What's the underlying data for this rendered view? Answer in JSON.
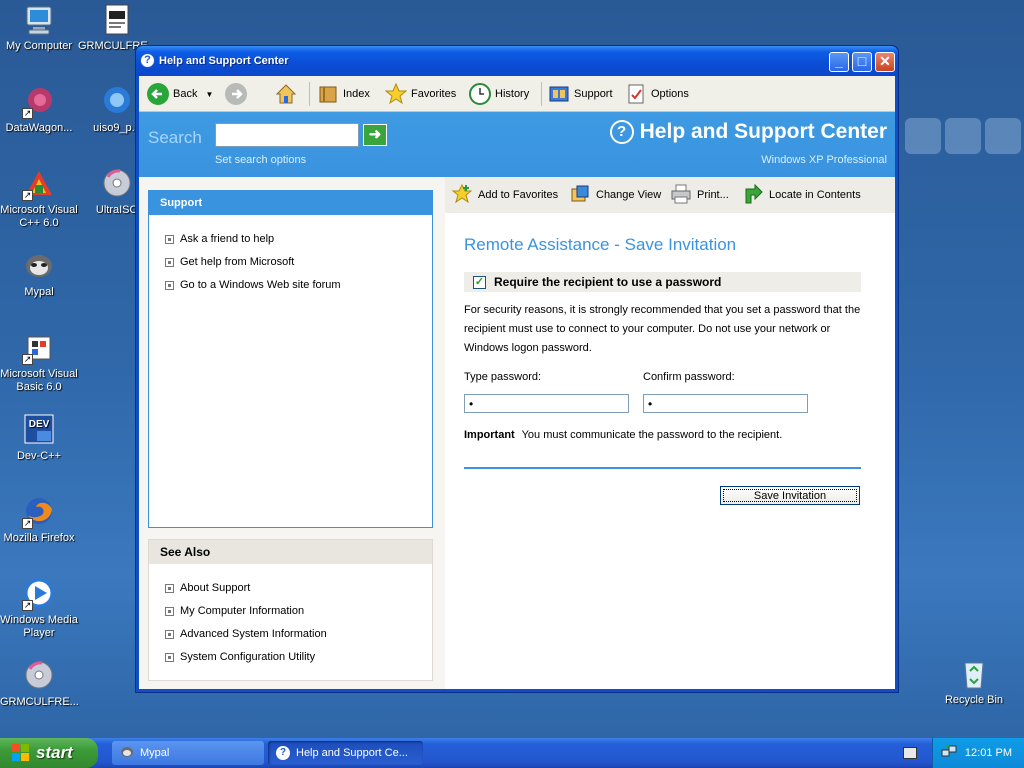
{
  "desktop": {
    "icons": [
      {
        "label": "My Computer"
      },
      {
        "label": "GRMCULFRE..."
      },
      {
        "label": "DataWagon..."
      },
      {
        "label": "uiso9_p..."
      },
      {
        "label": "Microsoft Visual C++ 6.0"
      },
      {
        "label": "UltraISO"
      },
      {
        "label": "Mypal"
      },
      {
        "label": "Microsoft Visual Basic 6.0"
      },
      {
        "label": "Dev-C++"
      },
      {
        "label": "Mozilla Firefox"
      },
      {
        "label": "Windows Media Player"
      },
      {
        "label": "GRMCULFRE..."
      },
      {
        "label": "Recycle Bin"
      }
    ]
  },
  "window": {
    "title": "Help and Support Center",
    "toolbar": {
      "back": "Back",
      "index": "Index",
      "favorites": "Favorites",
      "history": "History",
      "support": "Support",
      "options": "Options"
    },
    "search": {
      "label": "Search",
      "value": "",
      "options_link": "Set search options"
    },
    "header": {
      "title": "Help and Support Center",
      "subtitle": "Windows XP Professional"
    },
    "left": {
      "support_title": "Support",
      "support_links": [
        "Ask a friend to help",
        "Get help from Microsoft",
        "Go to a Windows Web site forum"
      ],
      "see_also_title": "See Also",
      "see_also_links": [
        "About Support",
        "My Computer Information",
        "Advanced System Information",
        "System Configuration Utility"
      ]
    },
    "right": {
      "toolbar": {
        "add_favorites": "Add to Favorites",
        "change_view": "Change View",
        "print": "Print...",
        "locate": "Locate in Contents"
      },
      "title": "Remote Assistance - Save Invitation",
      "require_password_label": "Require the recipient to use a password",
      "require_password_checked": true,
      "description": "For security reasons, it is strongly recommended that you set a password that the recipient must use to connect to your computer. Do not use your network or Windows logon password.",
      "type_password_label": "Type password:",
      "type_password_value": "•",
      "confirm_password_label": "Confirm password:",
      "confirm_password_value": "•",
      "important_label": "Important",
      "important_text": "You must communicate the password to the recipient.",
      "save_button": "Save Invitation"
    }
  },
  "taskbar": {
    "start": "start",
    "tasks": [
      "Mypal",
      "Help and Support Ce..."
    ],
    "clock": "12:01 PM"
  },
  "colors": {
    "accent": "#3a93df",
    "title_bar": "#0a4dd4",
    "desktop": "#2f67a8"
  }
}
